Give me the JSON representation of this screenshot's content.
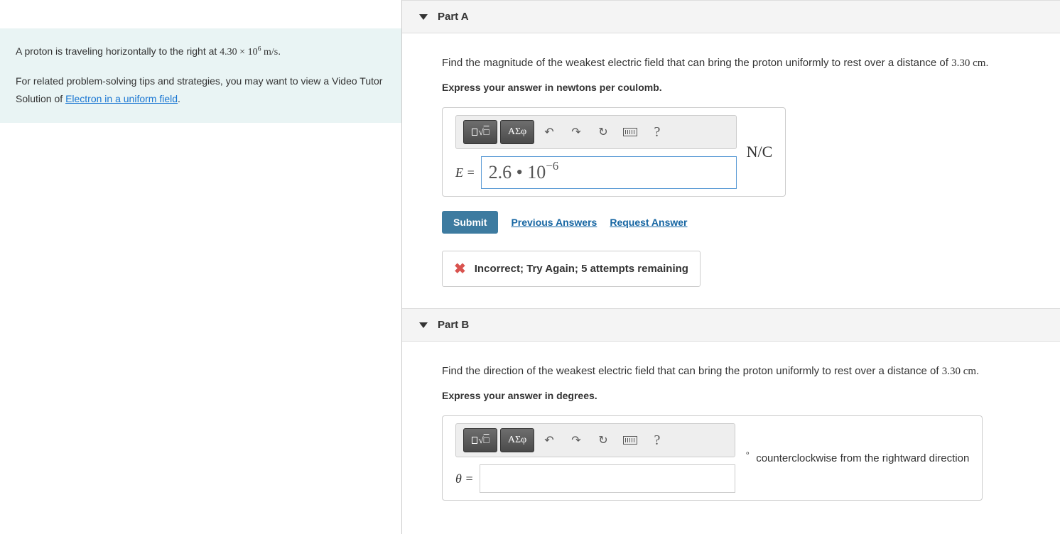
{
  "problem": {
    "text_before": "A proton is traveling horizontally to the right at ",
    "value_html": "4.30 × 10⁶ m/s",
    "text_after": ".",
    "tip_text": "For related problem-solving tips and strategies, you may want to view a Video Tutor Solution of ",
    "link_text": "Electron in a uniform field",
    "link_after": "."
  },
  "partA": {
    "title": "Part A",
    "question_before": "Find the magnitude of the weakest electric field that can bring the proton uniformly to rest over a distance of ",
    "distance": "3.30 cm",
    "question_after": ".",
    "instruction": "Express your answer in newtons per coulomb.",
    "symbols_btn": "ΑΣφ",
    "template_btn": "√",
    "eq_label": "E =",
    "input_value": "2.6 • 10⁻⁶",
    "unit": "N/C",
    "submit": "Submit",
    "prev_answers": "Previous Answers",
    "request_answer": "Request Answer",
    "feedback": "Incorrect; Try Again; 5 attempts remaining"
  },
  "partB": {
    "title": "Part B",
    "question_before": "Find the direction of the weakest electric field that can bring the proton uniformly to rest over a distance of ",
    "distance": "3.30 cm",
    "question_after": ".",
    "instruction": "Express your answer in degrees.",
    "symbols_btn": "ΑΣφ",
    "eq_label": "θ =",
    "input_value": "",
    "unit_sup": "∘",
    "trail": "counterclockwise from the rightward direction"
  }
}
